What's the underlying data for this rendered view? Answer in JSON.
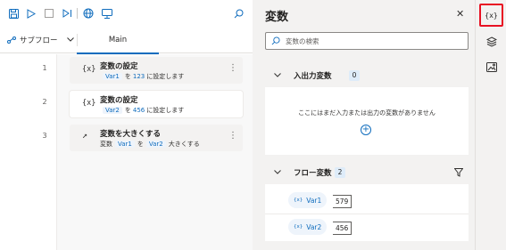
{
  "toolbar": {
    "icons": [
      "save-icon",
      "run-icon",
      "stop-icon",
      "step-icon",
      "web-recorder-icon",
      "desktop-recorder-icon",
      "search-icon"
    ]
  },
  "tabs": {
    "subflow_label": "サブフロー",
    "main_label": "Main"
  },
  "actions": [
    {
      "line": "1",
      "icon": "{x}",
      "title": "変数の設定",
      "desc": {
        "var": "Var1",
        "p1": "を",
        "value": "123",
        "p2": "に設定します"
      }
    },
    {
      "line": "2",
      "icon": "{x}",
      "title": "変数の設定",
      "desc": {
        "var": "Var2",
        "p1": "を",
        "value": "456",
        "p2": "に設定します"
      }
    },
    {
      "line": "3",
      "icon": "↗",
      "title": "変数を大きくする",
      "desc": {
        "pre": "変数",
        "var": "Var1",
        "p1": "を",
        "var2": "Var2",
        "p2": "大きくする"
      }
    }
  ],
  "variables_pane": {
    "title": "変数",
    "search_placeholder": "変数の検索",
    "io_section": {
      "title": "入出力変数",
      "count": "0",
      "empty_message": "ここにはまだ入力または出力の変数がありません"
    },
    "flow_section": {
      "title": "フロー変数",
      "count": "2",
      "items": [
        {
          "chip_icon": "{x}",
          "name": "Var1",
          "value": "579"
        },
        {
          "chip_icon": "{x}",
          "name": "Var2",
          "value": "456"
        }
      ]
    }
  },
  "rail": {
    "variables_label": "{x}",
    "icons": [
      "variables-icon",
      "ui-elements-icon",
      "images-icon"
    ]
  },
  "colors": {
    "accent": "#0f6cbd",
    "highlight_border": "#e81123",
    "pane_bg": "#f3f2f1"
  }
}
